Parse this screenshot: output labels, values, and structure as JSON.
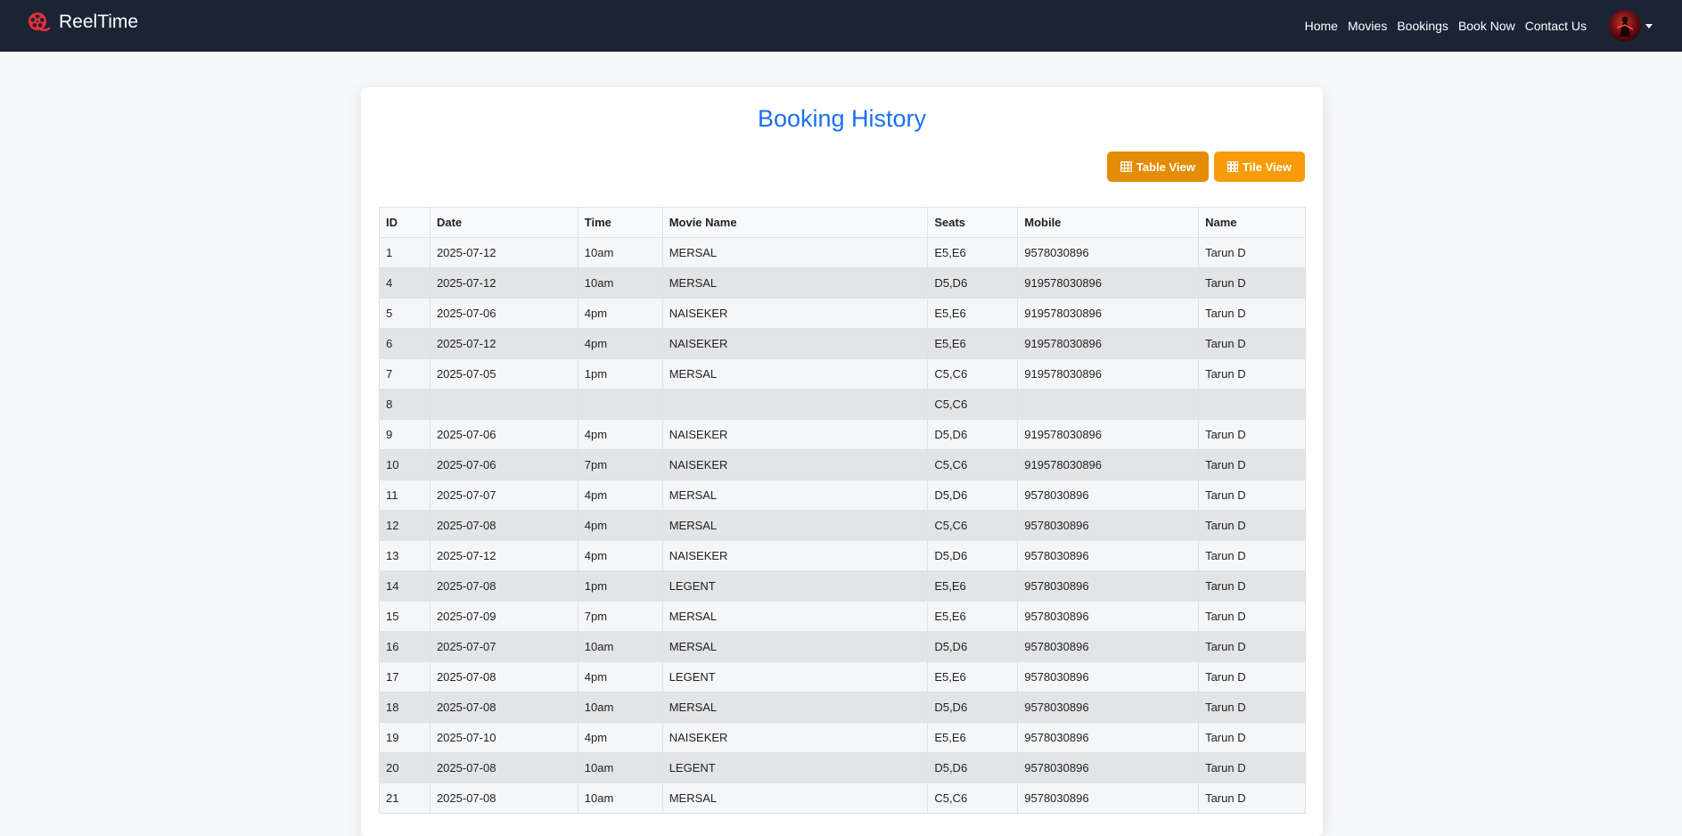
{
  "navbar": {
    "brand": "ReelTime",
    "links": [
      "Home",
      "Movies",
      "Bookings",
      "Book Now",
      "Contact Us"
    ]
  },
  "main": {
    "title": "Booking History",
    "buttons": {
      "table_view": "Table View",
      "tile_view": "Tile View"
    },
    "table": {
      "headers": [
        "ID",
        "Date",
        "Time",
        "Movie Name",
        "Seats",
        "Mobile",
        "Name"
      ],
      "rows": [
        [
          "1",
          "2025-07-12",
          "10am",
          "MERSAL",
          "E5,E6",
          "9578030896",
          "Tarun D"
        ],
        [
          "4",
          "2025-07-12",
          "10am",
          "MERSAL",
          "D5,D6",
          "919578030896",
          "Tarun D"
        ],
        [
          "5",
          "2025-07-06",
          "4pm",
          "NAISEKER",
          "E5,E6",
          "919578030896",
          "Tarun D"
        ],
        [
          "6",
          "2025-07-12",
          "4pm",
          "NAISEKER",
          "E5,E6",
          "919578030896",
          "Tarun D"
        ],
        [
          "7",
          "2025-07-05",
          "1pm",
          "MERSAL",
          "C5,C6",
          "919578030896",
          "Tarun D"
        ],
        [
          "8",
          "",
          "",
          "",
          "C5,C6",
          "",
          ""
        ],
        [
          "9",
          "2025-07-06",
          "4pm",
          "NAISEKER",
          "D5,D6",
          "919578030896",
          "Tarun D"
        ],
        [
          "10",
          "2025-07-06",
          "7pm",
          "NAISEKER",
          "C5,C6",
          "919578030896",
          "Tarun D"
        ],
        [
          "11",
          "2025-07-07",
          "4pm",
          "MERSAL",
          "D5,D6",
          "9578030896",
          "Tarun D"
        ],
        [
          "12",
          "2025-07-08",
          "4pm",
          "MERSAL",
          "C5,C6",
          "9578030896",
          "Tarun D"
        ],
        [
          "13",
          "2025-07-12",
          "4pm",
          "NAISEKER",
          "D5,D6",
          "9578030896",
          "Tarun D"
        ],
        [
          "14",
          "2025-07-08",
          "1pm",
          "LEGENT",
          "E5,E6",
          "9578030896",
          "Tarun D"
        ],
        [
          "15",
          "2025-07-09",
          "7pm",
          "MERSAL",
          "E5,E6",
          "9578030896",
          "Tarun D"
        ],
        [
          "16",
          "2025-07-07",
          "10am",
          "MERSAL",
          "D5,D6",
          "9578030896",
          "Tarun D"
        ],
        [
          "17",
          "2025-07-08",
          "4pm",
          "LEGENT",
          "E5,E6",
          "9578030896",
          "Tarun D"
        ],
        [
          "18",
          "2025-07-08",
          "10am",
          "MERSAL",
          "D5,D6",
          "9578030896",
          "Tarun D"
        ],
        [
          "19",
          "2025-07-10",
          "4pm",
          "NAISEKER",
          "E5,E6",
          "9578030896",
          "Tarun D"
        ],
        [
          "20",
          "2025-07-08",
          "10am",
          "LEGENT",
          "D5,D6",
          "9578030896",
          "Tarun D"
        ],
        [
          "21",
          "2025-07-08",
          "10am",
          "MERSAL",
          "C5,C6",
          "9578030896",
          "Tarun D"
        ]
      ]
    }
  },
  "colors": {
    "navbar_bg": "#1b2334",
    "brand_icon": "#e8303a",
    "title": "#1a6ff2",
    "button_bg": "#f79b07"
  },
  "icons": {
    "brand": "film-reel-icon",
    "table_view": "table-icon",
    "tile_view": "grid-icon",
    "avatar_dropdown": "caret-down-icon"
  }
}
